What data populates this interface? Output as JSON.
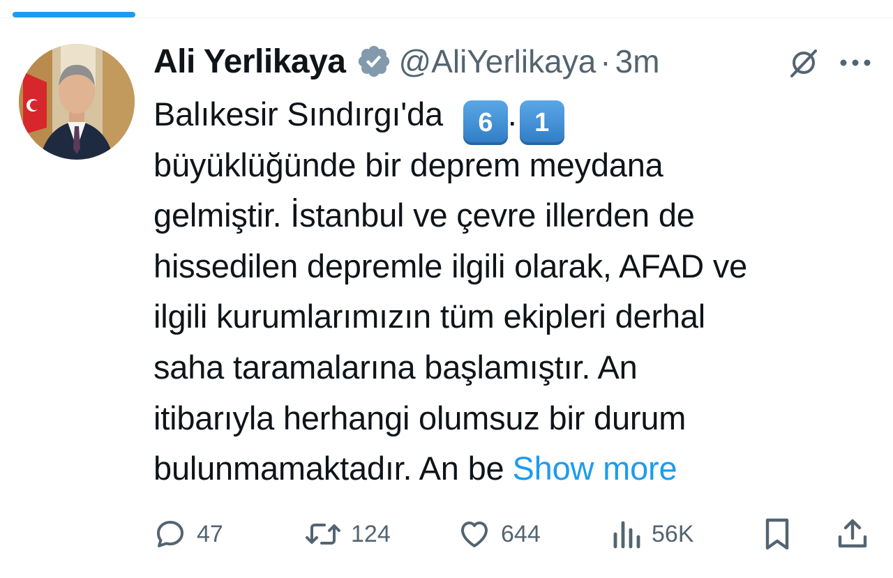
{
  "tweet": {
    "display_name": "Ali Yerlikaya",
    "handle": "@AliYerlikaya",
    "separator": "·",
    "time": "3m",
    "verified_icon": "verified-badge-icon",
    "body_lines": [
      "Balıkesir Sındırgı'da",
      "büyüklüğünde bir deprem meydana",
      "gelmiştir. İstanbul ve çevre illerden de",
      "hissedilen depremle ilgili olarak, AFAD ve",
      "ilgili kurumlarımızın tüm ekipleri derhal",
      "saha taramalarına başlamıştır. An",
      "itibarıyla herhangi olumsuz bir durum",
      "bulunmamaktadır. An be"
    ],
    "keycap_first": "6",
    "keycap_dot": ".",
    "keycap_second": "1",
    "show_more": "Show more"
  },
  "actions": {
    "replies": "47",
    "reposts": "124",
    "likes": "644",
    "views": "56K"
  },
  "colors": {
    "accent": "#1d9bf0",
    "secondary_text": "#536471",
    "primary_text": "#0f1419"
  }
}
